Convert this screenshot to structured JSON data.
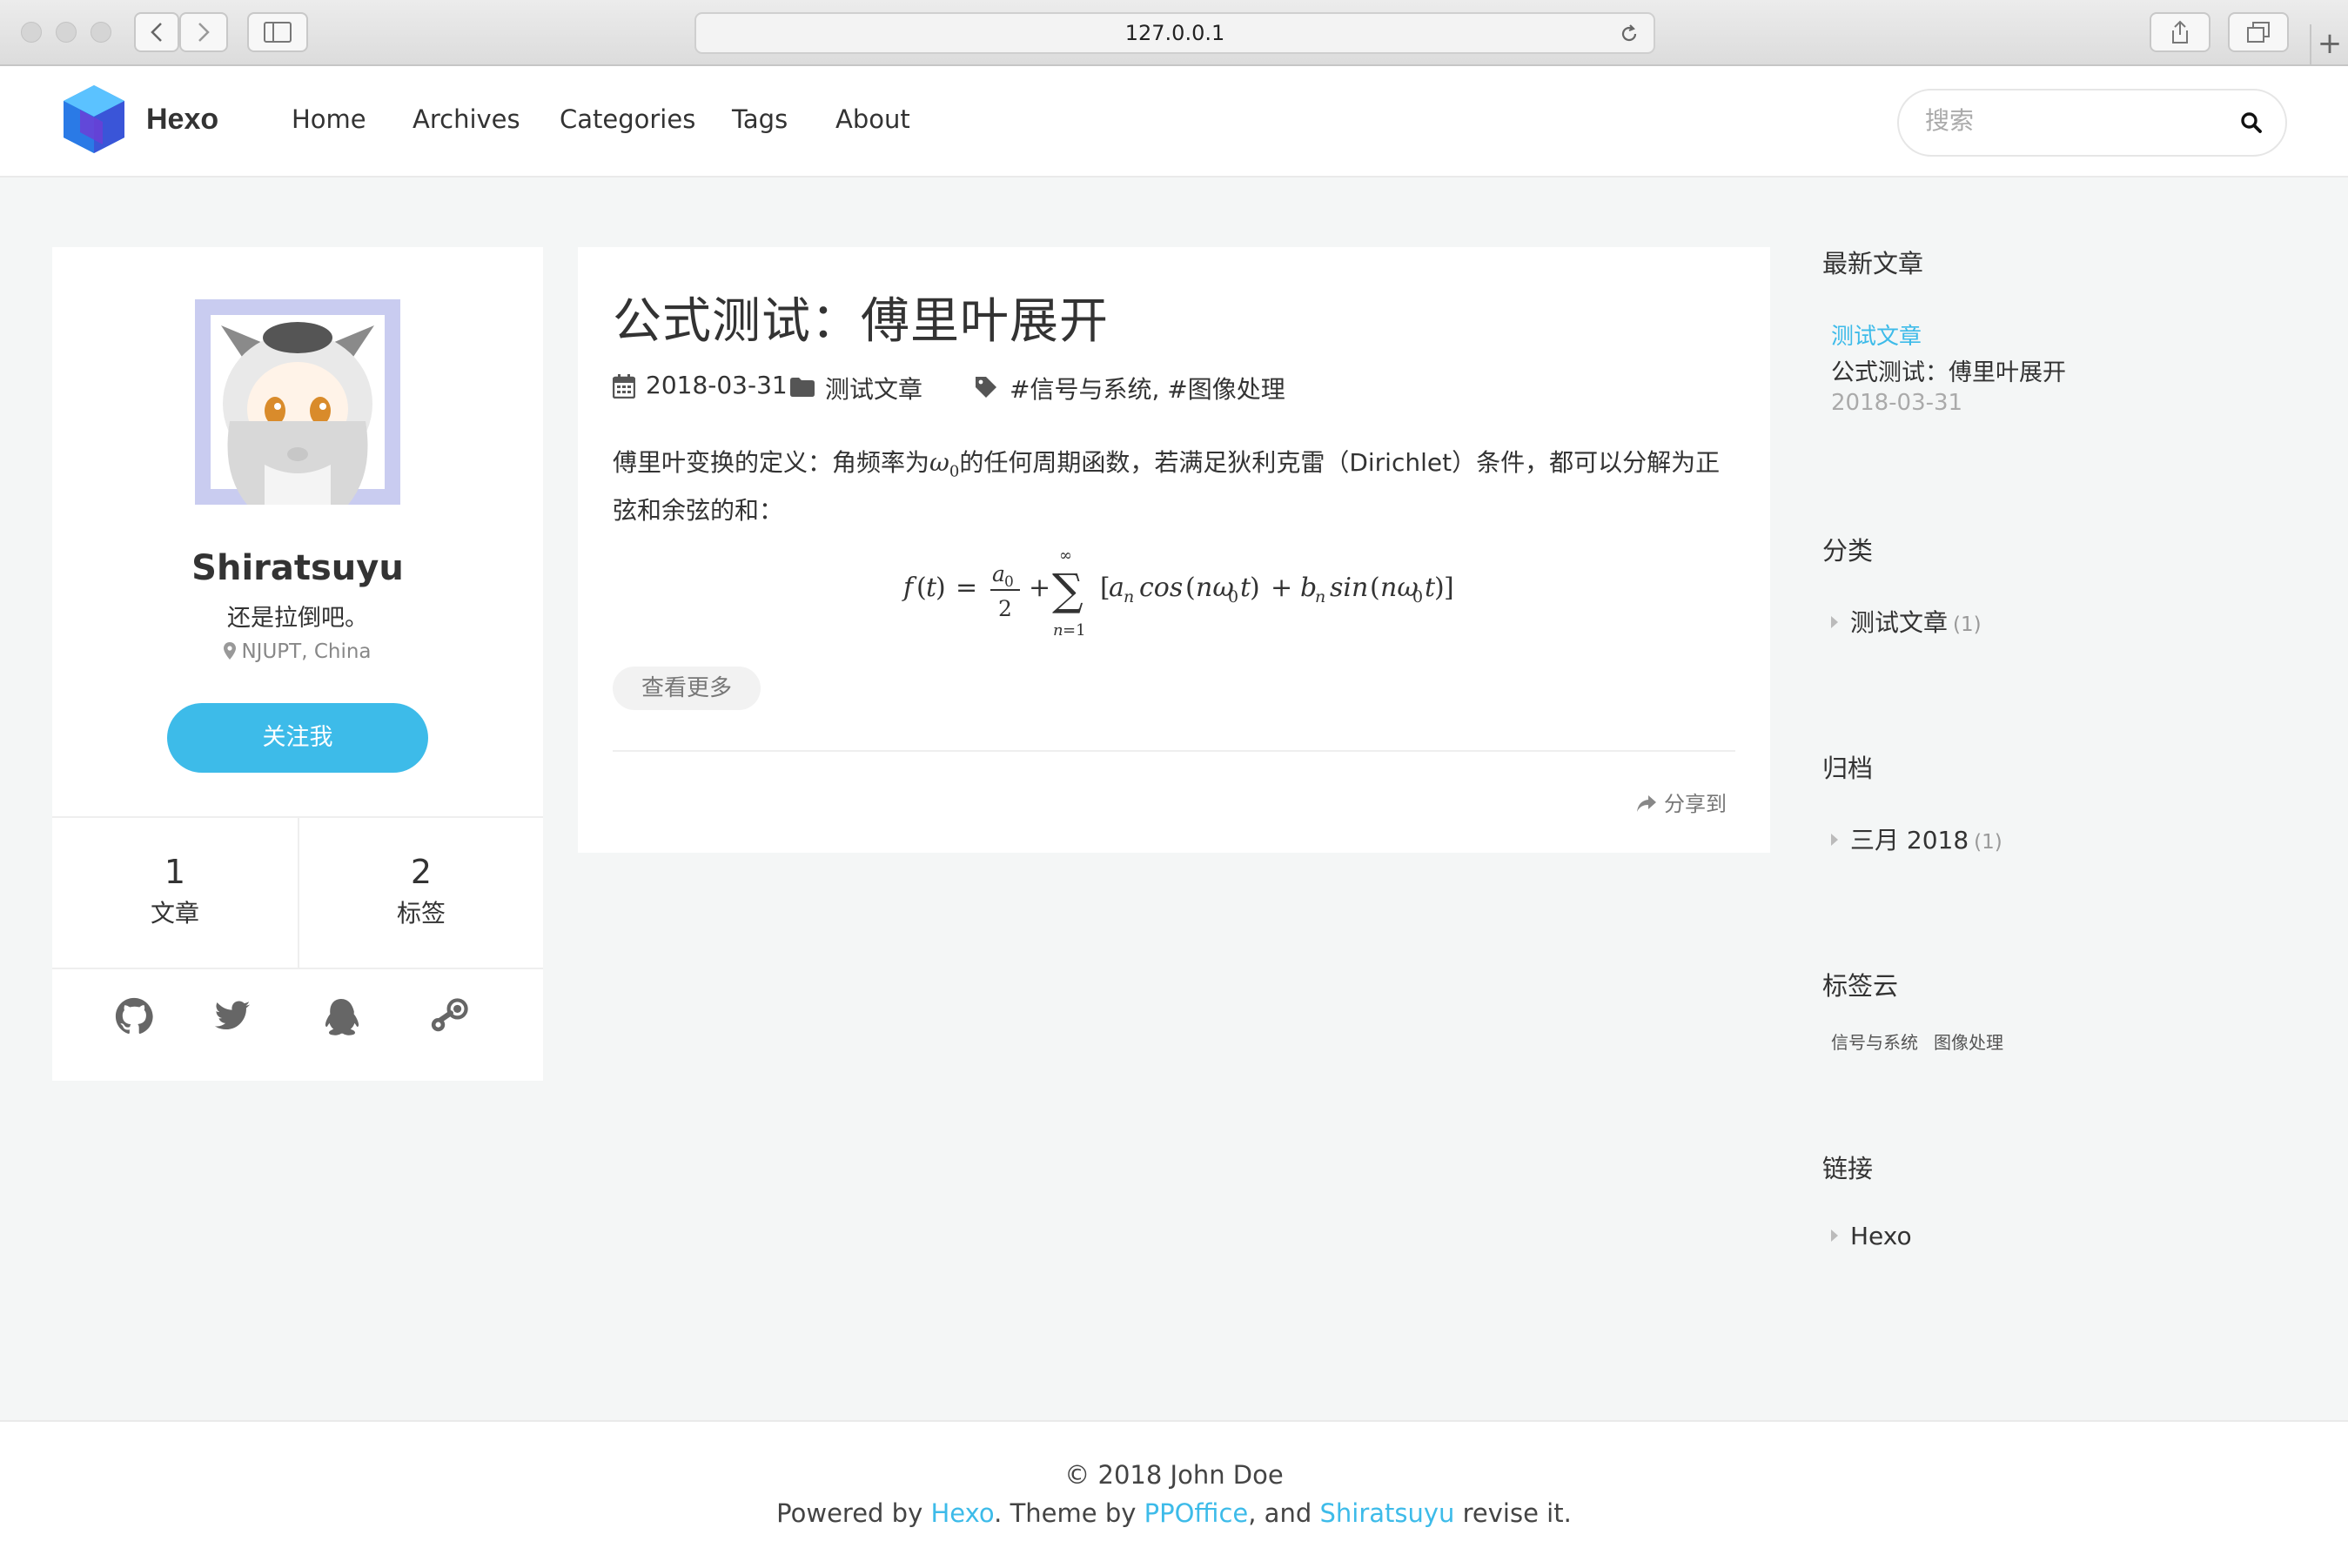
{
  "browser": {
    "url": "127.0.0.1"
  },
  "site": {
    "brand": "Hexo",
    "nav": [
      "Home",
      "Archives",
      "Categories",
      "Tags",
      "About"
    ],
    "search_placeholder": "搜索"
  },
  "profile": {
    "name": "Shiratsuyu",
    "bio": "还是拉倒吧。",
    "location": "NJUPT, China",
    "follow_label": "关注我",
    "stats": [
      {
        "value": "1",
        "label": "文章"
      },
      {
        "value": "2",
        "label": "标签"
      }
    ],
    "socials": [
      "github-icon",
      "twitter-icon",
      "qq-icon",
      "steam-icon"
    ]
  },
  "article": {
    "title": "公式测试：傅里叶展开",
    "date": "2018-03-31",
    "category": "测试文章",
    "tags": "#信号与系统, #图像处理",
    "para_before": "傅里叶变换的定义：角频率为",
    "para_omega": "ω",
    "para_omega_sub": "0",
    "para_after": "的任何周期函数，若满足狄利克雷（Dirichlet）条件，都可以分解为正弦和余弦的和：",
    "read_more": "查看更多",
    "share": "分享到"
  },
  "sidebar": {
    "recent": {
      "heading": "最新文章",
      "category": "测试文章",
      "title": "公式测试：傅里叶展开",
      "date": "2018-03-31"
    },
    "categories": {
      "heading": "分类",
      "items": [
        {
          "label": "测试文章",
          "count": "(1)"
        }
      ]
    },
    "archives": {
      "heading": "归档",
      "items": [
        {
          "label": "三月 2018",
          "count": "(1)"
        }
      ]
    },
    "tagcloud": {
      "heading": "标签云",
      "tags": [
        "信号与系统",
        "图像处理"
      ]
    },
    "links": {
      "heading": "链接",
      "items": [
        "Hexo"
      ]
    }
  },
  "footer": {
    "copyright": "© 2018 John Doe",
    "powered_prefix": "Powered by ",
    "powered_hexo": "Hexo",
    "theme_prefix": ". Theme by ",
    "theme_name": "PPOffice",
    "and_text": ", and ",
    "author": "Shiratsuyu",
    "suffix": " revise it."
  },
  "colors": {
    "accent": "#3dbbe9",
    "page_bg": "#f4f6f6"
  }
}
